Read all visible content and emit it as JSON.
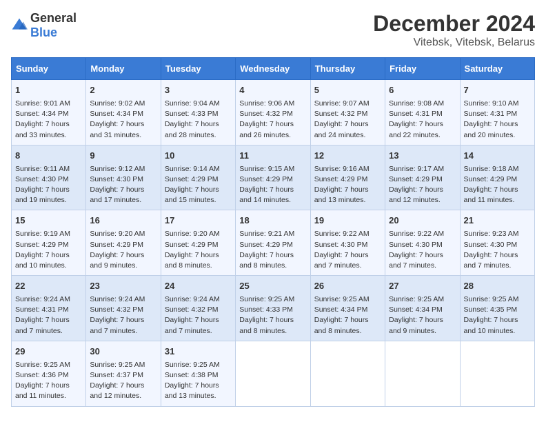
{
  "header": {
    "logo_general": "General",
    "logo_blue": "Blue",
    "month_title": "December 2024",
    "location": "Vitebsk, Vitebsk, Belarus"
  },
  "days_of_week": [
    "Sunday",
    "Monday",
    "Tuesday",
    "Wednesday",
    "Thursday",
    "Friday",
    "Saturday"
  ],
  "weeks": [
    [
      {
        "day": 1,
        "lines": [
          "Sunrise: 9:01 AM",
          "Sunset: 4:34 PM",
          "Daylight: 7 hours",
          "and 33 minutes."
        ]
      },
      {
        "day": 2,
        "lines": [
          "Sunrise: 9:02 AM",
          "Sunset: 4:34 PM",
          "Daylight: 7 hours",
          "and 31 minutes."
        ]
      },
      {
        "day": 3,
        "lines": [
          "Sunrise: 9:04 AM",
          "Sunset: 4:33 PM",
          "Daylight: 7 hours",
          "and 28 minutes."
        ]
      },
      {
        "day": 4,
        "lines": [
          "Sunrise: 9:06 AM",
          "Sunset: 4:32 PM",
          "Daylight: 7 hours",
          "and 26 minutes."
        ]
      },
      {
        "day": 5,
        "lines": [
          "Sunrise: 9:07 AM",
          "Sunset: 4:32 PM",
          "Daylight: 7 hours",
          "and 24 minutes."
        ]
      },
      {
        "day": 6,
        "lines": [
          "Sunrise: 9:08 AM",
          "Sunset: 4:31 PM",
          "Daylight: 7 hours",
          "and 22 minutes."
        ]
      },
      {
        "day": 7,
        "lines": [
          "Sunrise: 9:10 AM",
          "Sunset: 4:31 PM",
          "Daylight: 7 hours",
          "and 20 minutes."
        ]
      }
    ],
    [
      {
        "day": 8,
        "lines": [
          "Sunrise: 9:11 AM",
          "Sunset: 4:30 PM",
          "Daylight: 7 hours",
          "and 19 minutes."
        ]
      },
      {
        "day": 9,
        "lines": [
          "Sunrise: 9:12 AM",
          "Sunset: 4:30 PM",
          "Daylight: 7 hours",
          "and 17 minutes."
        ]
      },
      {
        "day": 10,
        "lines": [
          "Sunrise: 9:14 AM",
          "Sunset: 4:29 PM",
          "Daylight: 7 hours",
          "and 15 minutes."
        ]
      },
      {
        "day": 11,
        "lines": [
          "Sunrise: 9:15 AM",
          "Sunset: 4:29 PM",
          "Daylight: 7 hours",
          "and 14 minutes."
        ]
      },
      {
        "day": 12,
        "lines": [
          "Sunrise: 9:16 AM",
          "Sunset: 4:29 PM",
          "Daylight: 7 hours",
          "and 13 minutes."
        ]
      },
      {
        "day": 13,
        "lines": [
          "Sunrise: 9:17 AM",
          "Sunset: 4:29 PM",
          "Daylight: 7 hours",
          "and 12 minutes."
        ]
      },
      {
        "day": 14,
        "lines": [
          "Sunrise: 9:18 AM",
          "Sunset: 4:29 PM",
          "Daylight: 7 hours",
          "and 11 minutes."
        ]
      }
    ],
    [
      {
        "day": 15,
        "lines": [
          "Sunrise: 9:19 AM",
          "Sunset: 4:29 PM",
          "Daylight: 7 hours",
          "and 10 minutes."
        ]
      },
      {
        "day": 16,
        "lines": [
          "Sunrise: 9:20 AM",
          "Sunset: 4:29 PM",
          "Daylight: 7 hours",
          "and 9 minutes."
        ]
      },
      {
        "day": 17,
        "lines": [
          "Sunrise: 9:20 AM",
          "Sunset: 4:29 PM",
          "Daylight: 7 hours",
          "and 8 minutes."
        ]
      },
      {
        "day": 18,
        "lines": [
          "Sunrise: 9:21 AM",
          "Sunset: 4:29 PM",
          "Daylight: 7 hours",
          "and 8 minutes."
        ]
      },
      {
        "day": 19,
        "lines": [
          "Sunrise: 9:22 AM",
          "Sunset: 4:30 PM",
          "Daylight: 7 hours",
          "and 7 minutes."
        ]
      },
      {
        "day": 20,
        "lines": [
          "Sunrise: 9:22 AM",
          "Sunset: 4:30 PM",
          "Daylight: 7 hours",
          "and 7 minutes."
        ]
      },
      {
        "day": 21,
        "lines": [
          "Sunrise: 9:23 AM",
          "Sunset: 4:30 PM",
          "Daylight: 7 hours",
          "and 7 minutes."
        ]
      }
    ],
    [
      {
        "day": 22,
        "lines": [
          "Sunrise: 9:24 AM",
          "Sunset: 4:31 PM",
          "Daylight: 7 hours",
          "and 7 minutes."
        ]
      },
      {
        "day": 23,
        "lines": [
          "Sunrise: 9:24 AM",
          "Sunset: 4:32 PM",
          "Daylight: 7 hours",
          "and 7 minutes."
        ]
      },
      {
        "day": 24,
        "lines": [
          "Sunrise: 9:24 AM",
          "Sunset: 4:32 PM",
          "Daylight: 7 hours",
          "and 7 minutes."
        ]
      },
      {
        "day": 25,
        "lines": [
          "Sunrise: 9:25 AM",
          "Sunset: 4:33 PM",
          "Daylight: 7 hours",
          "and 8 minutes."
        ]
      },
      {
        "day": 26,
        "lines": [
          "Sunrise: 9:25 AM",
          "Sunset: 4:34 PM",
          "Daylight: 7 hours",
          "and 8 minutes."
        ]
      },
      {
        "day": 27,
        "lines": [
          "Sunrise: 9:25 AM",
          "Sunset: 4:34 PM",
          "Daylight: 7 hours",
          "and 9 minutes."
        ]
      },
      {
        "day": 28,
        "lines": [
          "Sunrise: 9:25 AM",
          "Sunset: 4:35 PM",
          "Daylight: 7 hours",
          "and 10 minutes."
        ]
      }
    ],
    [
      {
        "day": 29,
        "lines": [
          "Sunrise: 9:25 AM",
          "Sunset: 4:36 PM",
          "Daylight: 7 hours",
          "and 11 minutes."
        ]
      },
      {
        "day": 30,
        "lines": [
          "Sunrise: 9:25 AM",
          "Sunset: 4:37 PM",
          "Daylight: 7 hours",
          "and 12 minutes."
        ]
      },
      {
        "day": 31,
        "lines": [
          "Sunrise: 9:25 AM",
          "Sunset: 4:38 PM",
          "Daylight: 7 hours",
          "and 13 minutes."
        ]
      },
      null,
      null,
      null,
      null
    ]
  ]
}
